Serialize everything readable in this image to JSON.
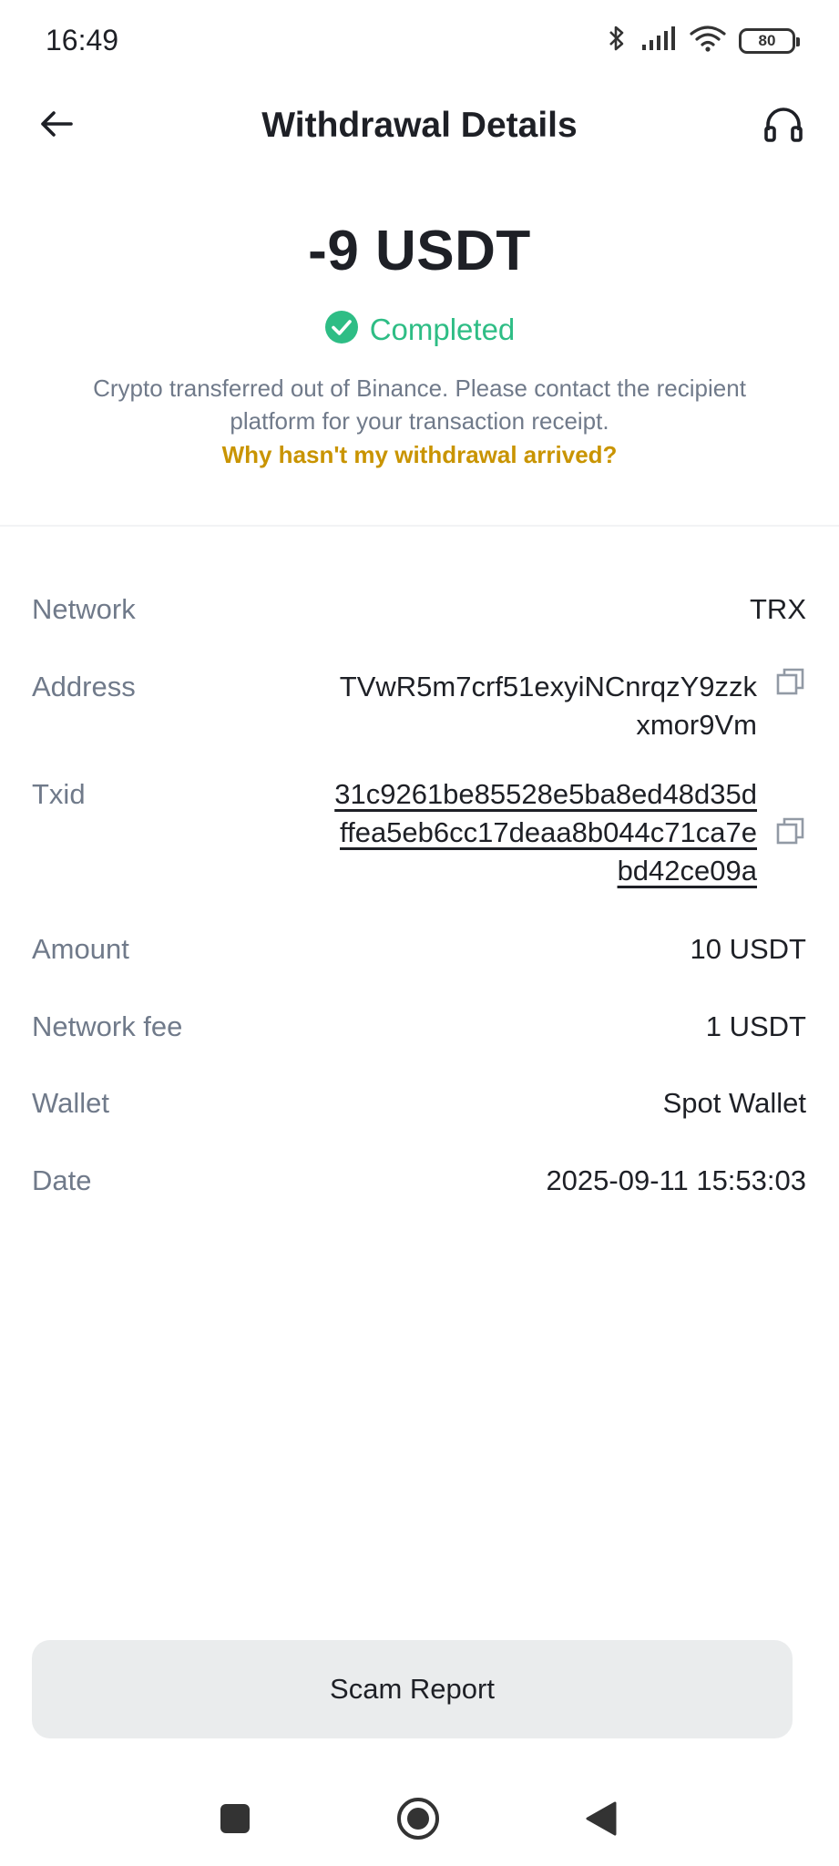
{
  "status_bar": {
    "time": "16:49",
    "battery": "80",
    "icons": [
      "bluetooth-icon",
      "signal-icon",
      "wifi-icon",
      "battery-icon"
    ]
  },
  "header": {
    "title": "Withdrawal Details",
    "back_icon": "arrow-left-icon",
    "support_icon": "headset-icon"
  },
  "summary": {
    "amount": "-9 USDT",
    "status": "Completed",
    "status_color": "#2ebd85",
    "note": "Crypto transferred out of Binance. Please contact the recipient platform for your transaction receipt.",
    "help_link": "Why hasn't my withdrawal arrived?",
    "help_link_color": "#c99400"
  },
  "details": {
    "network": {
      "label": "Network",
      "value": "TRX"
    },
    "address": {
      "label": "Address",
      "value": "TVwR5m7crf51exyiNCnrqzY9zzkxmor9Vm"
    },
    "txid": {
      "label": "Txid",
      "value": "31c9261be85528e5ba8ed48d35dffea5eb6cc17deaa8b044c71ca7ebd42ce09a"
    },
    "amount": {
      "label": "Amount",
      "value": "10 USDT"
    },
    "fee": {
      "label": "Network fee",
      "value": "1 USDT"
    },
    "wallet": {
      "label": "Wallet",
      "value": "Spot Wallet"
    },
    "date": {
      "label": "Date",
      "value": "2025-09-11 15:53:03"
    }
  },
  "actions": {
    "scam_report": "Scam Report"
  },
  "nav": {
    "icons": [
      "recents-square-icon",
      "home-circle-icon",
      "back-triangle-icon"
    ]
  }
}
